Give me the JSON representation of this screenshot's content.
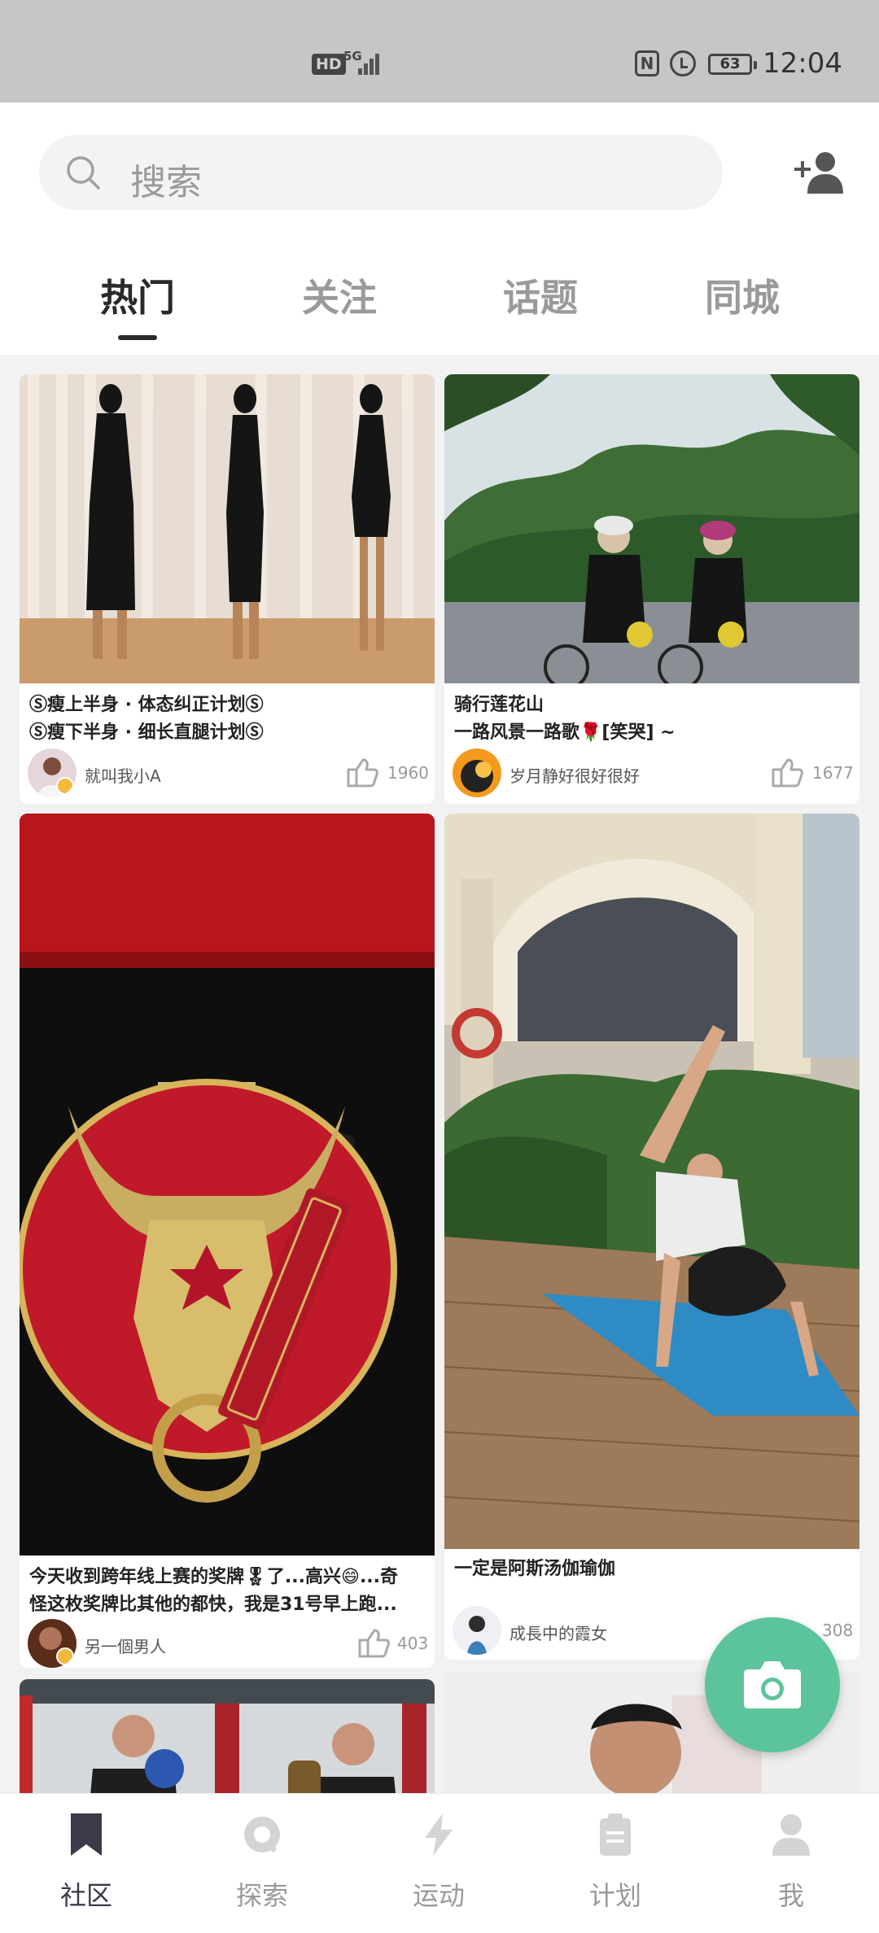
{
  "status_bar": {
    "hd": "HD",
    "network": "5G",
    "battery": "63",
    "time": "12:04"
  },
  "search": {
    "placeholder": "搜索"
  },
  "tabs": [
    {
      "label": "热门",
      "active": true
    },
    {
      "label": "关注",
      "active": false
    },
    {
      "label": "话题",
      "active": false
    },
    {
      "label": "同城",
      "active": false
    }
  ],
  "feed": {
    "cards": [
      {
        "title_line1": "Ⓢ瘦上半身 · 体态纠正计划Ⓢ",
        "title_line2": "Ⓢ瘦下半身 · 细长直腿计划Ⓢ",
        "author": "就叫我小A",
        "likes": "1960"
      },
      {
        "title_line1": "骑行莲花山",
        "title_line2": "一路风景一路歌🌹[笑哭] ~",
        "author": "岁月静好很好很好",
        "likes": "1677"
      },
      {
        "title_line1": "今天收到跨年线上赛的奖牌🎖了...高兴😄...奇",
        "title_line2": "怪这枚奖牌比其他的都快，我是31号早上跑...",
        "author": "另一個男人",
        "likes": "403"
      },
      {
        "title_line1": "一定是阿斯汤伽瑜伽",
        "title_line2": "",
        "author": "成長中的霞女",
        "likes": "308"
      }
    ]
  },
  "colors": {
    "accent": "#5cc49a",
    "active_text": "#2a2a2a",
    "inactive_text": "#9a9a9a"
  },
  "bottom_nav": [
    {
      "label": "社区",
      "icon": "bookmark-icon",
      "active": true
    },
    {
      "label": "探索",
      "icon": "explore-icon",
      "active": false
    },
    {
      "label": "运动",
      "icon": "lightning-icon",
      "active": false
    },
    {
      "label": "计划",
      "icon": "clipboard-icon",
      "active": false
    },
    {
      "label": "我",
      "icon": "person-icon",
      "active": false
    }
  ]
}
